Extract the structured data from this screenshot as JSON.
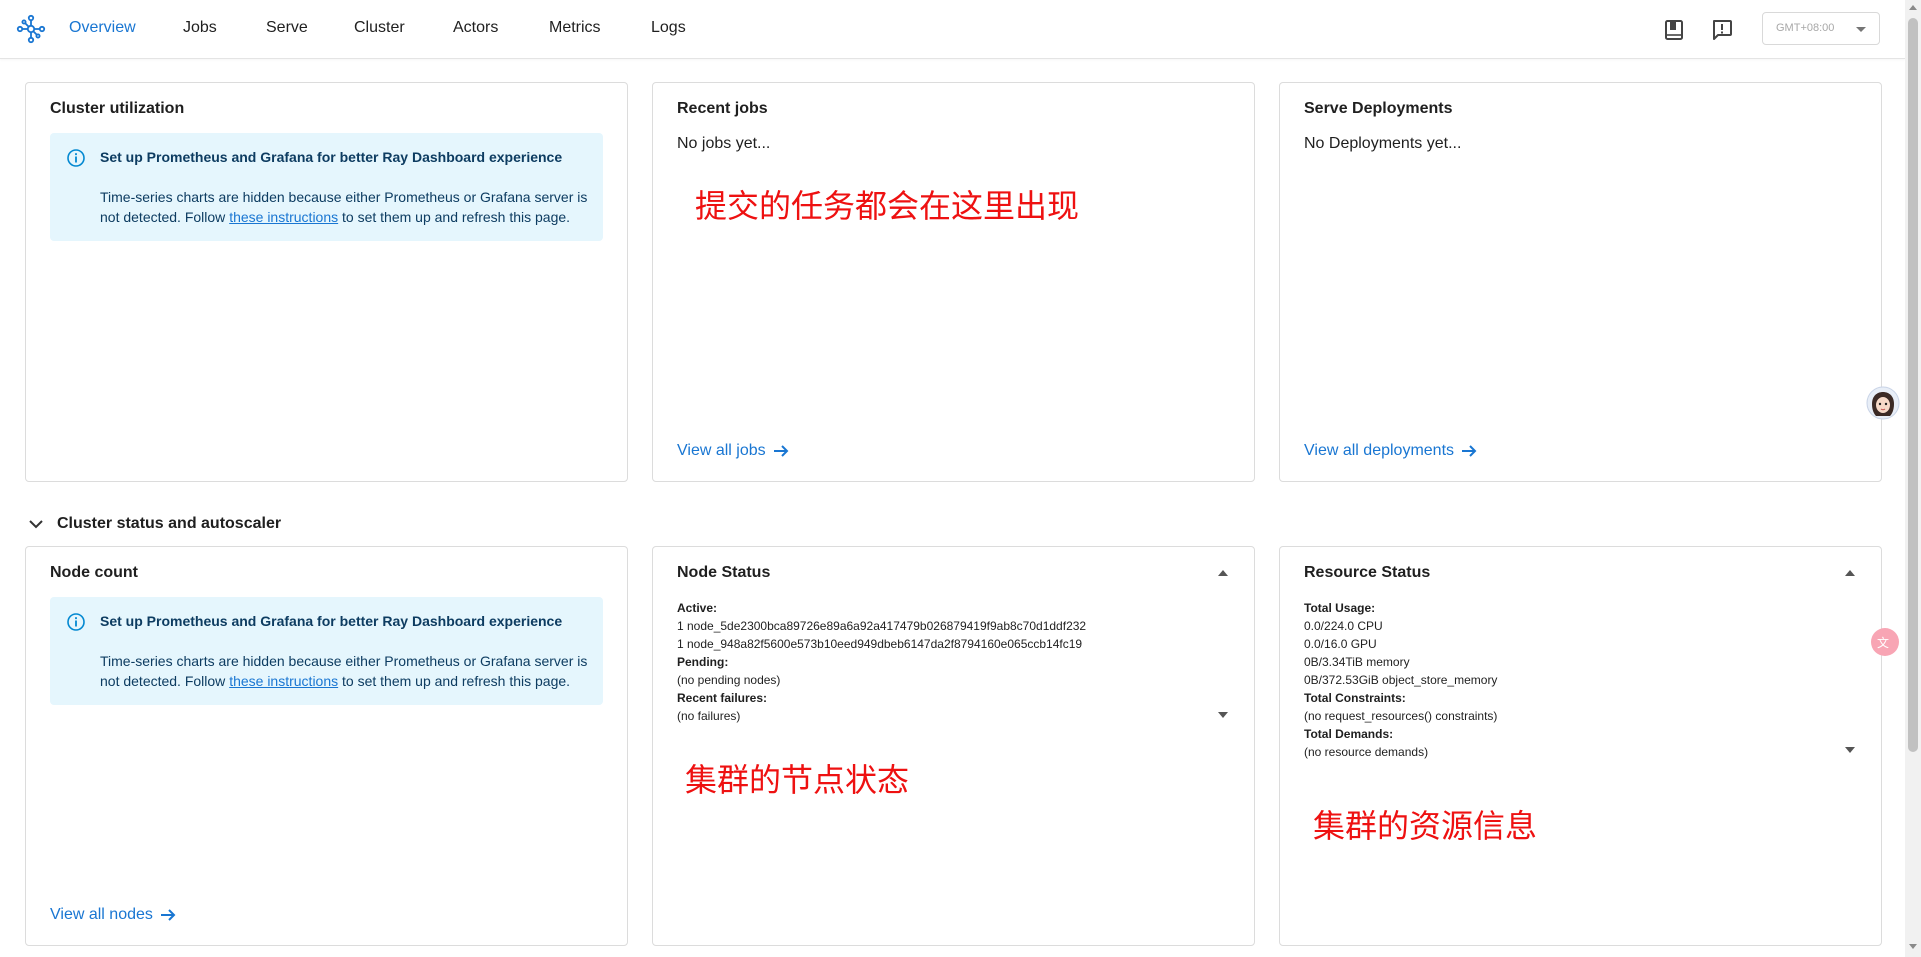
{
  "nav": {
    "items": [
      {
        "label": "Overview",
        "active": true
      },
      {
        "label": "Jobs",
        "active": false
      },
      {
        "label": "Serve",
        "active": false
      },
      {
        "label": "Cluster",
        "active": false
      },
      {
        "label": "Actors",
        "active": false
      },
      {
        "label": "Metrics",
        "active": false
      },
      {
        "label": "Logs",
        "active": false
      }
    ],
    "timezone": "GMT+08:00",
    "icons": [
      "docs-book-icon",
      "feedback-icon"
    ]
  },
  "cluster_utilization": {
    "title": "Cluster utilization",
    "alert": {
      "title": "Set up Prometheus and Grafana for better Ray Dashboard experience",
      "body_before": "Time-series charts are hidden because either Prometheus or Grafana server is not detected. Follow ",
      "link": "these instructions",
      "body_after": " to set them up and refresh this page."
    }
  },
  "recent_jobs": {
    "title": "Recent jobs",
    "empty": "No jobs yet...",
    "annotation": "提交的任务都会在这里出现",
    "link": "View all jobs"
  },
  "serve_deployments": {
    "title": "Serve Deployments",
    "empty": "No Deployments yet...",
    "link": "View all deployments"
  },
  "section": {
    "title": "Cluster status and autoscaler"
  },
  "node_count": {
    "title": "Node count",
    "alert": {
      "title": "Set up Prometheus and Grafana for better Ray Dashboard experience",
      "body_before": "Time-series charts are hidden because either Prometheus or Grafana server is not detected. Follow ",
      "link": "these instructions",
      "body_after": " to set them up and refresh this page."
    },
    "link": "View all nodes"
  },
  "node_status": {
    "title": "Node Status",
    "active_label": "Active:",
    "active_nodes": [
      "1 node_5de2300bca89726e89a6a92a417479b026879419f9ab8c70d1ddf232",
      "1 node_948a82f5600e573b10eed949dbeb6147da2f8794160e065ccb14fc19"
    ],
    "pending_label": "Pending:",
    "pending_value": "(no pending nodes)",
    "failures_label": "Recent failures:",
    "failures_value": "(no failures)",
    "annotation": "集群的节点状态"
  },
  "resource_status": {
    "title": "Resource Status",
    "usage_label": "Total Usage:",
    "usage": [
      "0.0/224.0 CPU",
      "0.0/16.0 GPU",
      "0B/3.34TiB memory",
      "0B/372.53GiB object_store_memory"
    ],
    "constraints_label": "Total Constraints:",
    "constraints_value": "(no request_resources() constraints)",
    "demands_label": "Total Demands:",
    "demands_value": "(no resource demands)",
    "annotation": "集群的资源信息"
  },
  "colors": {
    "accent": "#1976d2",
    "alert_bg": "#e5f6fd",
    "annotation": "#ee1111"
  }
}
